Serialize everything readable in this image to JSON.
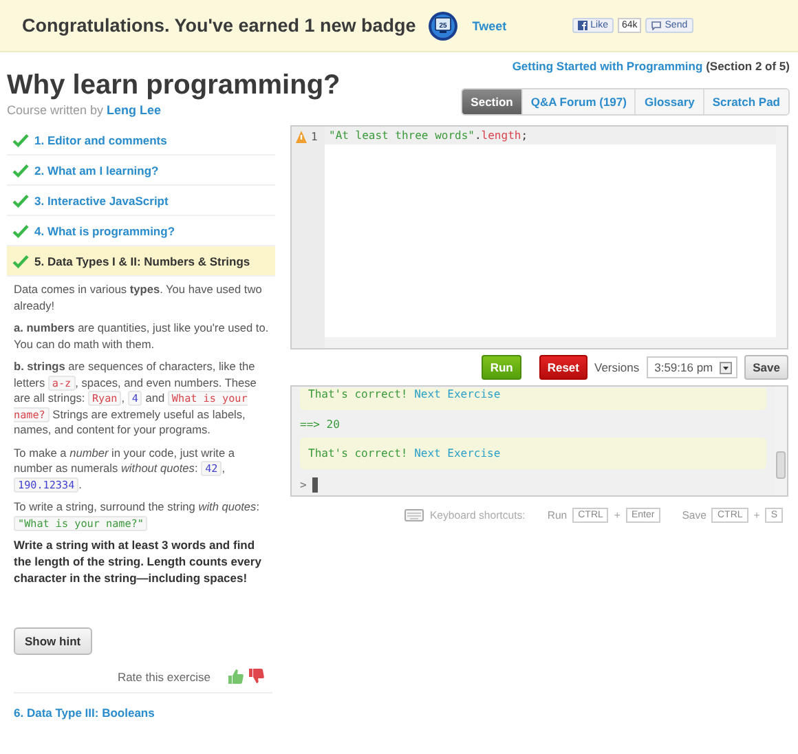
{
  "banner": {
    "message": "Congratulations. You've earned 1 new badge",
    "badge_number": "25",
    "tweet": "Tweet",
    "like": "Like",
    "like_count": "64k",
    "send": "Send"
  },
  "breadcrumb": {
    "course": "Getting Started with Programming",
    "section": "(Section 2 of 5)"
  },
  "title": "Why learn programming?",
  "byline": {
    "prefix": "Course written by",
    "author": "Leng Lee"
  },
  "tabs": [
    {
      "label": "Section",
      "selected": true
    },
    {
      "label": "Q&A Forum (197)",
      "selected": false
    },
    {
      "label": "Glossary",
      "selected": false
    },
    {
      "label": "Scratch Pad",
      "selected": false
    }
  ],
  "lessons": [
    {
      "label": "1. Editor and comments",
      "completed": true,
      "selected": false
    },
    {
      "label": "2. What am I learning?",
      "completed": true,
      "selected": false
    },
    {
      "label": "3. Interactive JavaScript",
      "completed": true,
      "selected": false
    },
    {
      "label": "4. What is programming?",
      "completed": true,
      "selected": false
    },
    {
      "label": "5. Data Types I & II: Numbers & Strings",
      "completed": true,
      "selected": true
    }
  ],
  "paragraphs": [
    [
      {
        "kind": "text",
        "text": "Data comes in various **types**. You have used two already!"
      }
    ],
    [
      {
        "kind": "text",
        "text": "**a. numbers** are quantities, just like you're used to. You can do math with them."
      }
    ],
    [
      {
        "kind": "text",
        "text": "**b. strings** are sequences of characters, like the letters "
      },
      {
        "kind": "string",
        "text": "a-z"
      },
      {
        "kind": "text",
        "text": ", spaces, and even numbers. These are all strings: "
      },
      {
        "kind": "string",
        "text": "Ryan"
      },
      {
        "kind": "text",
        "text": ", "
      },
      {
        "kind": "number",
        "text": "4"
      },
      {
        "kind": "text",
        "text": " and "
      },
      {
        "kind": "string",
        "text": "What is your name?"
      },
      {
        "kind": "text",
        "text": " Strings are extremely useful as labels, names, and content for your programs."
      }
    ],
    [
      {
        "kind": "text",
        "text": "To make a *number* in your code, just write a number as numerals *without quotes*: "
      },
      {
        "kind": "number",
        "text": "42"
      },
      {
        "kind": "text",
        "text": ", "
      },
      {
        "kind": "number",
        "text": "190.12334"
      },
      {
        "kind": "text",
        "text": "."
      }
    ],
    [
      {
        "kind": "text",
        "text": "To write a string, surround the string *with quotes*: "
      },
      {
        "kind": "quoted",
        "text": "\"What is your name?\""
      }
    ]
  ],
  "instruction": "Write a string with at least 3 words and find the length of the string. Length counts every character in the string—including spaces!",
  "hint_button": "Show hint",
  "rating": {
    "label": "Rate this exercise"
  },
  "next_lesson": "6. Data Type III: Booleans",
  "editor": {
    "line_number": "1",
    "warning": true,
    "tokens": [
      {
        "kind": "string",
        "text": "\"At least three words\""
      },
      {
        "kind": "plain",
        "text": "."
      },
      {
        "kind": "property",
        "text": "length"
      },
      {
        "kind": "plain",
        "text": ";"
      }
    ]
  },
  "controls": {
    "run": "Run",
    "reset": "Reset",
    "versions_label": "Versions",
    "version": "3:59:16 pm",
    "save": "Save"
  },
  "console": {
    "lines": [
      {
        "kind": "success",
        "message": "That's correct!",
        "link": "Next Exercise"
      },
      {
        "kind": "result",
        "text": "==> 20"
      },
      {
        "kind": "success",
        "message": "That's correct!",
        "link": "Next Exercise"
      },
      {
        "kind": "prompt",
        "text": ">"
      }
    ]
  },
  "shortcuts": {
    "label": "Keyboard shortcuts:",
    "items": [
      {
        "action": "Run",
        "keys": [
          "CTRL",
          "Enter"
        ],
        "separator": "+"
      },
      {
        "action": "Save",
        "keys": [
          "CTRL",
          "S"
        ],
        "separator": "+"
      }
    ]
  }
}
